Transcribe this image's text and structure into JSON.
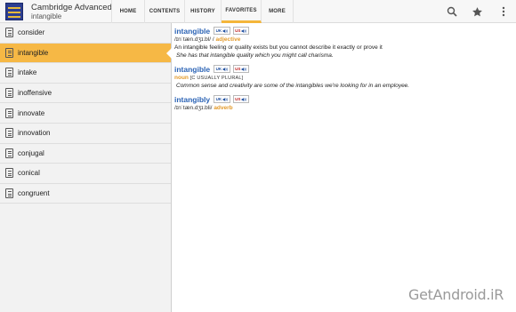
{
  "app": {
    "title": "Cambridge Advanced",
    "subtitle": "intangible"
  },
  "tabs": [
    {
      "label": "HOME"
    },
    {
      "label": "CONTENTS"
    },
    {
      "label": "HISTORY"
    },
    {
      "label": "FAVORITES",
      "active": true
    },
    {
      "label": "MORE"
    }
  ],
  "actions": [
    "search-icon",
    "star-icon",
    "overflow-menu-icon"
  ],
  "sidebar": {
    "items": [
      {
        "label": "consider"
      },
      {
        "label": "intangible",
        "selected": true
      },
      {
        "label": "intake"
      },
      {
        "label": "inoffensive"
      },
      {
        "label": "innovate"
      },
      {
        "label": "innovation"
      },
      {
        "label": "conjugal"
      },
      {
        "label": "conical"
      },
      {
        "label": "congruent"
      }
    ]
  },
  "entries": [
    {
      "headword": "intangible",
      "uk": "UK",
      "us": "US",
      "pron": "/ɪnˈtæn.dʒɪ.bl/",
      "sep": "/",
      "pos": "adjective",
      "definition": "An intangible feeling or quality exists but you cannot describe it exactly or prove it",
      "example": "She has that intangible quality which you might call charisma."
    },
    {
      "headword": "intangible",
      "uk": "UK",
      "us": "US",
      "pos": "noun",
      "grammar": "[C USUALLY PLURAL]",
      "example": "Common sense and creativity are some of the intangibles we're looking for in an employee."
    },
    {
      "headword": "intangibly",
      "uk": "UK",
      "us": "US",
      "pron": "/ɪnˈtæn.dʒɪ.bli/",
      "pos": "adverb"
    }
  ],
  "watermark": "GetAndroid.iR",
  "colors": {
    "accent": "#f6b845",
    "headword": "#2b63b5",
    "pos": "#e39a2a",
    "us_badge": "#c02525",
    "uk_badge": "#1f4f9f"
  }
}
